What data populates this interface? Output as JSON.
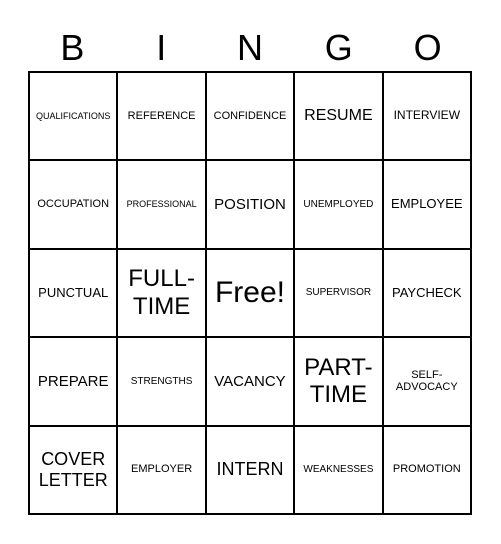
{
  "header": {
    "letters": [
      "B",
      "I",
      "N",
      "G",
      "O"
    ]
  },
  "cells": [
    {
      "text": "QUALIFICATIONS",
      "size": "s9"
    },
    {
      "text": "REFERENCE",
      "size": "s11"
    },
    {
      "text": "CONFIDENCE",
      "size": "s11"
    },
    {
      "text": "RESUME",
      "size": "s16"
    },
    {
      "text": "INTERVIEW",
      "size": "s12"
    },
    {
      "text": "OCCUPATION",
      "size": "s11"
    },
    {
      "text": "PROFESSIONAL",
      "size": "s9"
    },
    {
      "text": "POSITION",
      "size": "s15"
    },
    {
      "text": "UNEMPLOYED",
      "size": "s10"
    },
    {
      "text": "EMPLOYEE",
      "size": "s13"
    },
    {
      "text": "PUNCTUAL",
      "size": "s13"
    },
    {
      "text": "FULL-TIME",
      "size": "s24"
    },
    {
      "text": "Free!",
      "size": "s30"
    },
    {
      "text": "SUPERVISOR",
      "size": "s10"
    },
    {
      "text": "PAYCHECK",
      "size": "s13"
    },
    {
      "text": "PREPARE",
      "size": "s15"
    },
    {
      "text": "STRENGTHS",
      "size": "s10"
    },
    {
      "text": "VACANCY",
      "size": "s15"
    },
    {
      "text": "PART-TIME",
      "size": "s24"
    },
    {
      "text": "SELF-ADVOCACY",
      "size": "s11"
    },
    {
      "text": "COVER LETTER",
      "size": "s18"
    },
    {
      "text": "EMPLOYER",
      "size": "s11"
    },
    {
      "text": "INTERN",
      "size": "s18"
    },
    {
      "text": "WEAKNESSES",
      "size": "s10"
    },
    {
      "text": "PROMOTION",
      "size": "s11"
    }
  ]
}
